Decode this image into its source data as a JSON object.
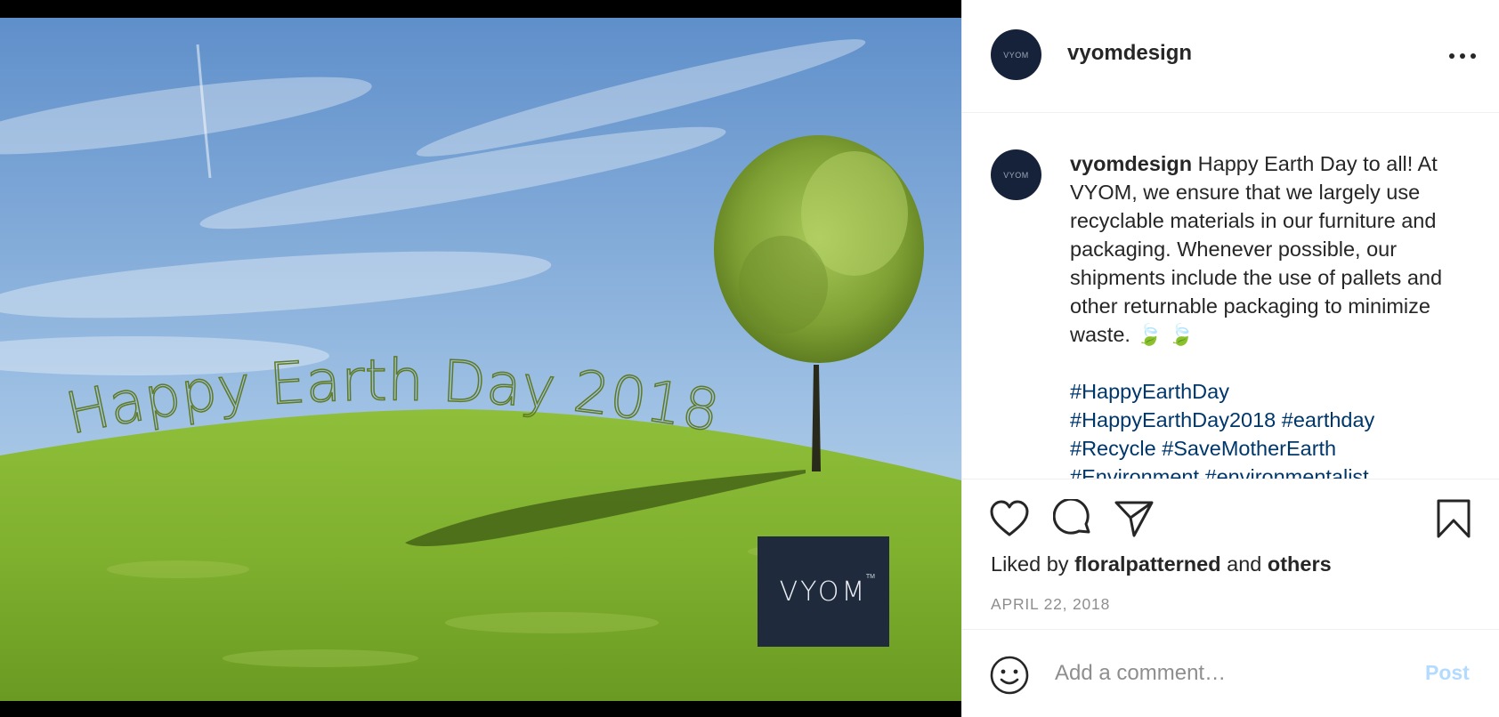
{
  "post": {
    "username": "vyomdesign",
    "avatar_text": "VYOM",
    "image": {
      "overlay_text": "Happy Earth Day 2018",
      "badge_text": "VYOM",
      "badge_trademark": "TM"
    },
    "caption": {
      "username": "vyomdesign",
      "text": "Happy Earth Day to all! At VYOM, we ensure that we largely use recyclable materials in our furniture and packaging. Whenever possible, our shipments include the use of pallets and other returnable packaging to minimize waste. 🍃 🍃",
      "hashtags": [
        "#HappyEarthDay",
        "#HappyEarthDay2018",
        "#earthday",
        "#Recycle",
        "#SaveMotherEarth",
        "#Environment",
        "#environmentalist"
      ]
    },
    "likes": {
      "prefix": "Liked by",
      "user": "floralpatterned",
      "conjunction": "and",
      "others": "others"
    },
    "date": "APRIL 22, 2018"
  },
  "comment_box": {
    "placeholder": "Add a comment…",
    "post_label": "Post"
  },
  "icons": [
    "more-options-icon",
    "heart-icon",
    "comment-icon",
    "share-icon",
    "bookmark-icon",
    "emoji-icon"
  ],
  "colors": {
    "hashtag": "#00376b",
    "post_button_disabled": "#b3dbff",
    "secondary_text": "#8e8e8e",
    "primary_text": "#262626",
    "avatar_bg": "#15223a"
  }
}
